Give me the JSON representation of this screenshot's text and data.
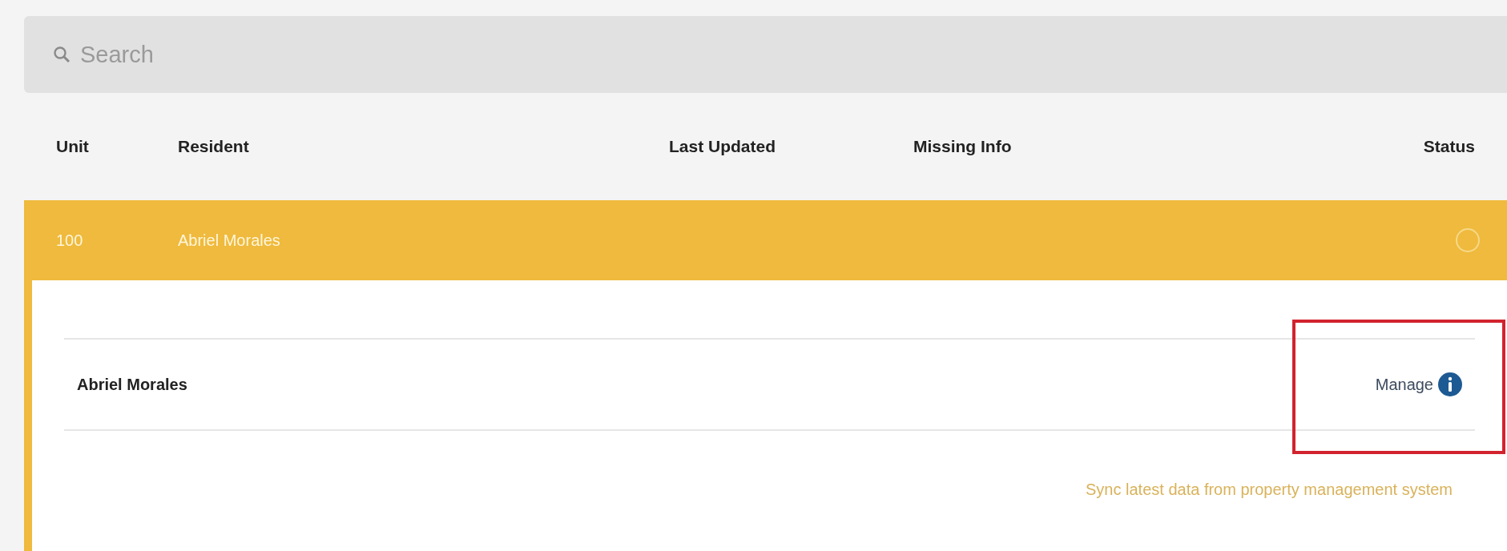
{
  "search": {
    "placeholder": "Search"
  },
  "columns": [
    {
      "label": "Unit",
      "kind": "unit"
    },
    {
      "label": "Resident",
      "kind": "resident"
    },
    {
      "label": "Last Updated",
      "kind": "updated"
    },
    {
      "label": "Missing Info",
      "kind": "missing"
    },
    {
      "label": "Status",
      "kind": "status"
    }
  ],
  "rows": [
    {
      "unit": "100",
      "resident": "Abriel Morales",
      "expanded": true,
      "status_checked": false,
      "residents": [
        {
          "name": "Abriel Morales",
          "action": "Manage",
          "highlighted": true
        }
      ],
      "sync_link": "Sync latest data from property management system"
    }
  ]
}
